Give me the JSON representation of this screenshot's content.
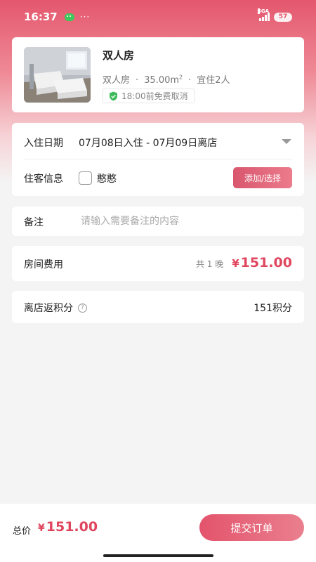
{
  "status_bar": {
    "time": "16:37",
    "network": "5GA",
    "battery": "57"
  },
  "room": {
    "name": "双人房",
    "type": "双人房",
    "area": "35.00m",
    "area_unit_sup": "2",
    "occupancy": "宜住2人",
    "cancel_policy": "18:00前免费取消",
    "cancel_icon": "shield-check-icon",
    "photo": "room-photo"
  },
  "booking": {
    "date_label": "入住日期",
    "date_value": "07月08日入住 - 07月09日离店",
    "guest_label": "住客信息",
    "guest_name": "憨憨",
    "guest_checked": false,
    "add_button": "添加/选择"
  },
  "remark": {
    "label": "备注",
    "placeholder": "请输入需要备注的内容",
    "value": ""
  },
  "fee": {
    "label": "房间费用",
    "nights": "共 1 晚",
    "currency": "¥",
    "amount": "151.00"
  },
  "points": {
    "label": "离店返积分",
    "value": "151积分"
  },
  "footer": {
    "total_label": "总价",
    "currency": "¥",
    "total": "151.00",
    "submit": "提交订单"
  },
  "colors": {
    "accent": "#e0455e",
    "header_gradient_top": "#e4576e",
    "background": "#f4f4f4"
  }
}
